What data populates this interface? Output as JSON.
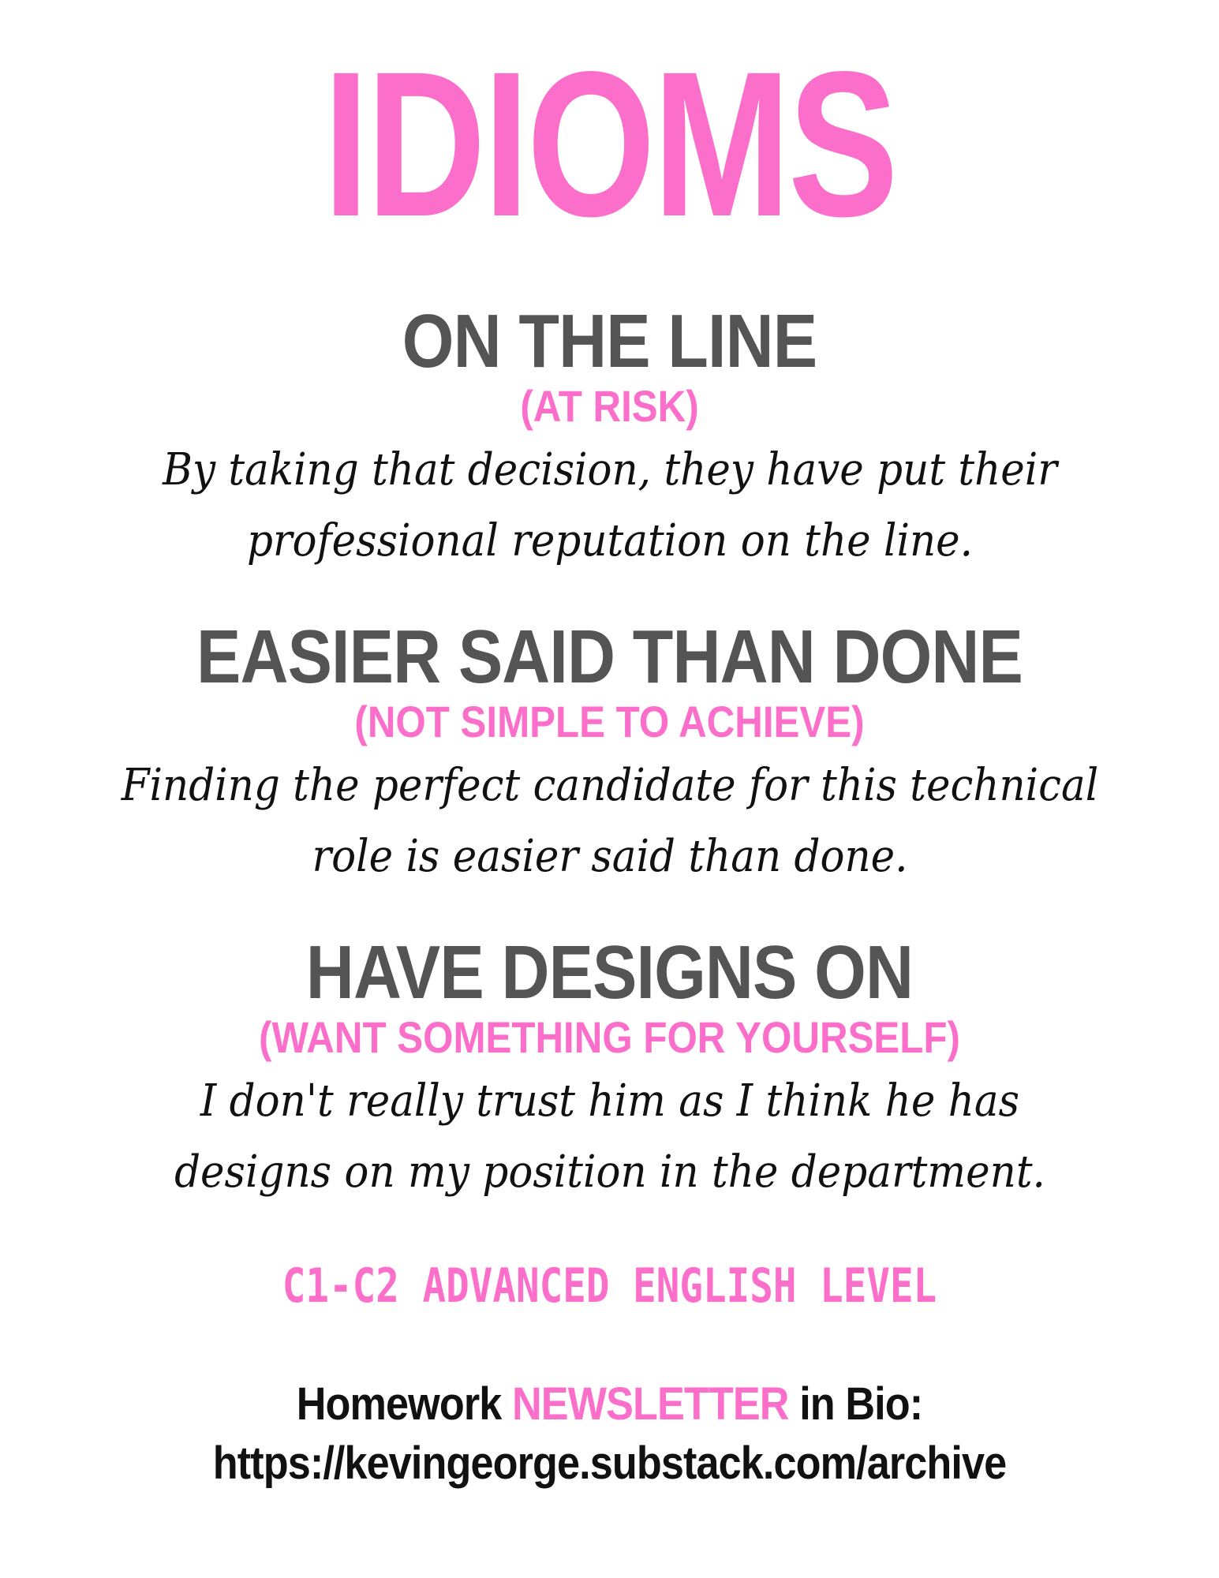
{
  "colors": {
    "accent_pink": "#fb6ec9",
    "heading_gray": "#545454",
    "text_black": "#111111",
    "background": "#ffffff"
  },
  "title": "IDIOMS",
  "idioms": [
    {
      "phrase": "ON THE LINE",
      "meaning": "(AT RISK)",
      "example": "By taking that decision, they have put their professional reputation on the line."
    },
    {
      "phrase": "EASIER SAID THAN DONE",
      "meaning": "(NOT SIMPLE TO ACHIEVE)",
      "example": "Finding the perfect candidate for this technical role is easier said than done."
    },
    {
      "phrase": "HAVE DESIGNS ON",
      "meaning": "(WANT SOMETHING FOR YOURSELF)",
      "example": "I don't really trust him as I think he has designs on my position in the department."
    }
  ],
  "level": "C1-C2 ADVANCED ENGLISH LEVEL",
  "footer": {
    "prefix": "Homework ",
    "highlight": "NEWSLETTER",
    "suffix": " in Bio:",
    "url": "https://kevingeorge.substack.com/archive"
  }
}
